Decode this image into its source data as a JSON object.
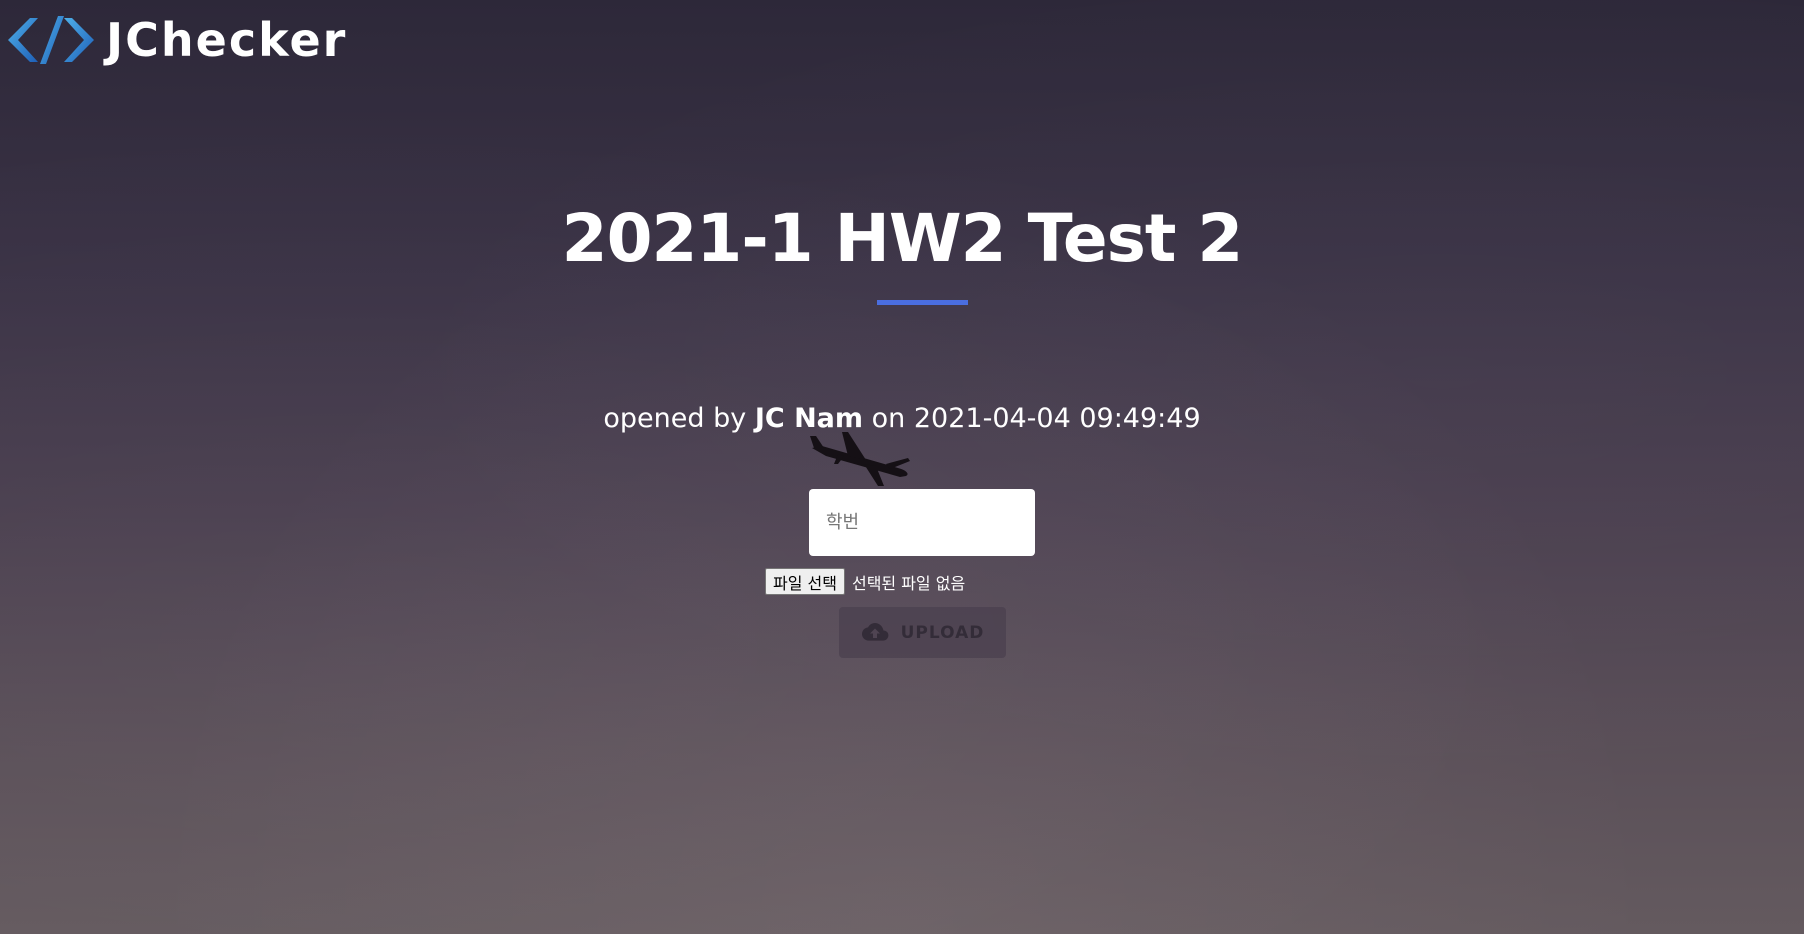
{
  "brand": {
    "name": "JChecker",
    "icon": "code-brackets-icon"
  },
  "page": {
    "title": "2021-1 HW2 Test 2",
    "accent_color": "#4a6ee0"
  },
  "meta": {
    "prefix": "opened by",
    "author": "JC Nam",
    "connector": "on",
    "timestamp": "2021-04-04 09:49:49"
  },
  "form": {
    "student_id_placeholder": "학번",
    "student_id_value": "",
    "file_button_label": "파일 선택",
    "file_status": "선택된 파일 없음",
    "upload_label": "UPLOAD",
    "upload_icon": "cloud-upload-icon"
  }
}
